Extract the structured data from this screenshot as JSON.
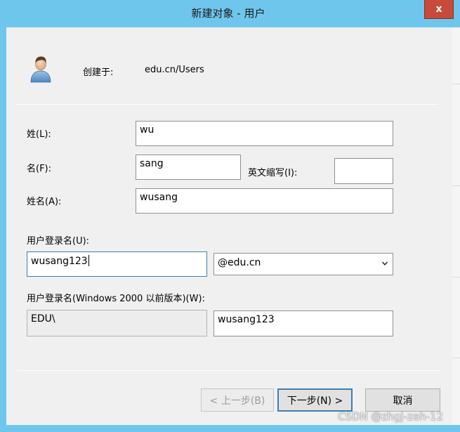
{
  "window": {
    "title": "新建对象 - 用户",
    "close_label": "x"
  },
  "header": {
    "create_in_label": "创建于:",
    "create_in_path": "edu.cn/Users"
  },
  "form": {
    "last_name_label": "姓(L):",
    "last_name_value": "wu",
    "first_name_label": "名(F):",
    "first_name_value": "sang",
    "initials_label": "英文缩写(I):",
    "initials_value": "",
    "full_name_label": "姓名(A):",
    "full_name_value": "wusang",
    "logon_label": "用户登录名(U):",
    "logon_value": "wusang123",
    "domain_suffix_selected": "@edu.cn",
    "pre2000_label": "用户登录名(Windows 2000 以前版本)(W):",
    "pre2000_domain": "EDU\\",
    "pre2000_value": "wusang123"
  },
  "buttons": {
    "back": "< 上一步(B)",
    "next": "下一步(N) >",
    "cancel": "取消"
  },
  "watermark": "CSDN @zhgj-zeh-12",
  "colors": {
    "title_bar": "#6ec6ec",
    "close_button": "#c74a3a",
    "dialog_background": "#f0f0f0",
    "focus_border": "#3c7fb1"
  },
  "icons": {
    "avatar": "user-icon",
    "close": "close-icon",
    "dropdown": "chevron-down-icon"
  }
}
